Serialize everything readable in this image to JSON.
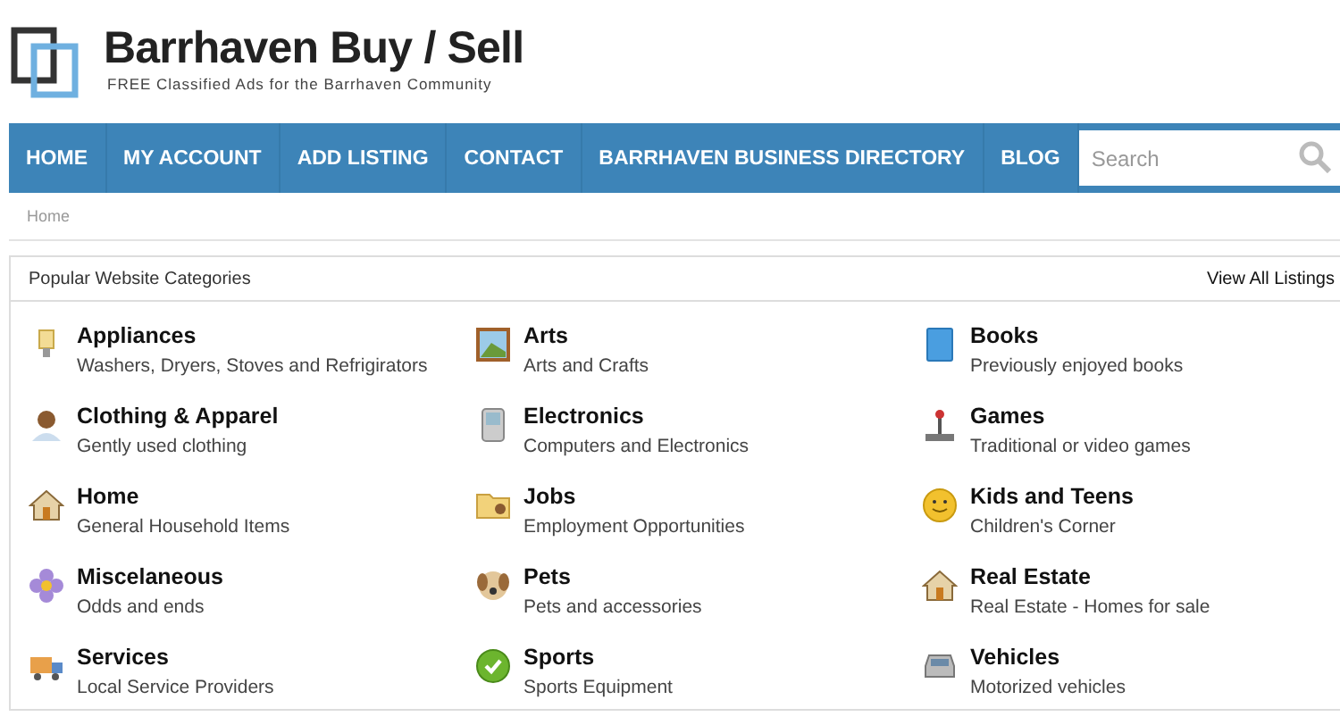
{
  "site": {
    "title": "Barrhaven Buy / Sell",
    "tagline": "FREE Classified Ads for the Barrhaven Community"
  },
  "nav": {
    "items": [
      {
        "label": "HOME"
      },
      {
        "label": "MY ACCOUNT"
      },
      {
        "label": "ADD LISTING"
      },
      {
        "label": "CONTACT"
      },
      {
        "label": "BARRHAVEN BUSINESS DIRECTORY"
      },
      {
        "label": "BLOG"
      }
    ],
    "search": {
      "placeholder": "Search"
    }
  },
  "breadcrumb": [
    "Home"
  ],
  "categories_panel": {
    "title": "Popular Website Categories",
    "view_all": "View All Listings",
    "items": [
      {
        "kind": "bulb",
        "name": "Appliances",
        "description": "Washers, Dryers, Stoves and Refrigirators"
      },
      {
        "kind": "picture",
        "name": "Arts",
        "description": "Arts and Crafts"
      },
      {
        "kind": "book",
        "name": "Books",
        "description": "Previously enjoyed books"
      },
      {
        "kind": "person",
        "name": "Clothing & Apparel",
        "description": "Gently used clothing"
      },
      {
        "kind": "phone",
        "name": "Electronics",
        "description": "Computers and Electronics"
      },
      {
        "kind": "joystick",
        "name": "Games",
        "description": "Traditional or video games"
      },
      {
        "kind": "house",
        "name": "Home",
        "description": "General Household Items"
      },
      {
        "kind": "folder",
        "name": "Jobs",
        "description": "Employment Opportunities"
      },
      {
        "kind": "smiley",
        "name": "Kids and Teens",
        "description": "Children's Corner"
      },
      {
        "kind": "flower",
        "name": "Miscelaneous",
        "description": "Odds and ends"
      },
      {
        "kind": "dog",
        "name": "Pets",
        "description": "Pets and accessories"
      },
      {
        "kind": "house",
        "name": "Real Estate",
        "description": "Real Estate - Homes for sale"
      },
      {
        "kind": "truck",
        "name": "Services",
        "description": "Local Service Providers"
      },
      {
        "kind": "check",
        "name": "Sports",
        "description": "Sports Equipment"
      },
      {
        "kind": "car",
        "name": "Vehicles",
        "description": "Motorized vehicles"
      }
    ]
  }
}
